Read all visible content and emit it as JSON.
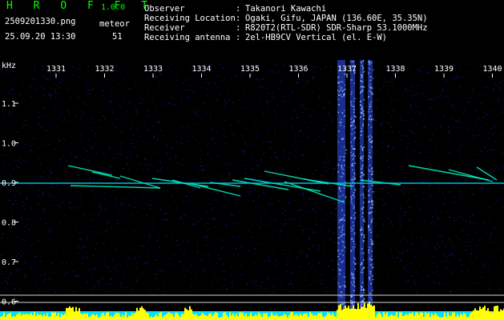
{
  "header": {
    "app_title": "H R O F F T",
    "app_version": "1.0.0",
    "filename": "2509201330.png",
    "meteor_label": "meteor",
    "datetime": "25.09.20 13:30",
    "meteor_count": "51"
  },
  "info": [
    {
      "key": "Observer",
      "value": "Takanori Kawachi"
    },
    {
      "key": "Receiving Location",
      "value": "Ogaki, Gifu, JAPAN (136.60E, 35.35N)"
    },
    {
      "key": "Receiver",
      "value": "R820T2(RTL-SDR) SDR-Sharp 53.1000MHz"
    },
    {
      "key": "Receiving antenna",
      "value": "2el-HB9CV Vertical (el. E-W)"
    }
  ],
  "separator": ":",
  "y_unit": "kHz",
  "x_ticks": [
    "1331",
    "1332",
    "1333",
    "1334",
    "1335",
    "1336",
    "1337",
    "1338",
    "1339",
    "1340"
  ],
  "y_ticks": [
    "1.1",
    "1.0",
    "0.9",
    "0.8",
    "0.7",
    "0.6"
  ],
  "colors": {
    "background": "#000000",
    "noise": "#1a1a9a",
    "carrier": "#00d0ff",
    "trace": "#00ffcc",
    "bar_yellow": "#ffff00",
    "bar_cyan": "#00e0ff",
    "title_green": "#00ff00"
  }
}
